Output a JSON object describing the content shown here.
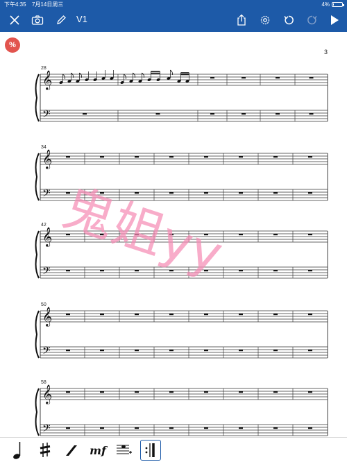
{
  "status": {
    "time": "下午4:35",
    "date": "7月14日周三",
    "battery_text": "4%",
    "battery_level": 0.04
  },
  "toolbar": {
    "version": "V1",
    "close_icon": "close-icon",
    "camera_icon": "camera-icon",
    "edit_icon": "pencil-icon",
    "share_icon": "share-icon",
    "settings_icon": "gear-icon",
    "undo_icon": "undo-icon",
    "redo_icon": "redo-icon",
    "play_icon": "play-icon"
  },
  "score": {
    "badge": "%",
    "page_number": "3",
    "systems": [
      {
        "start_measure": "28"
      },
      {
        "start_measure": "34"
      },
      {
        "start_measure": "42"
      },
      {
        "start_measure": "50"
      },
      {
        "start_measure": "58"
      }
    ]
  },
  "watermark": "鬼姐yy",
  "bottom_tools": [
    {
      "name": "quarter-note-icon"
    },
    {
      "name": "sharp-icon"
    },
    {
      "name": "slur-icon"
    },
    {
      "name": "dynamic-mf",
      "label": "mf"
    },
    {
      "name": "add-staff-icon"
    },
    {
      "name": "repeat-barline-icon"
    }
  ],
  "colors": {
    "toolbar": "#1d5aa8",
    "badge": "#e2544e",
    "watermark": "#f58cb4",
    "selected_tool": "#1d5aa8"
  }
}
